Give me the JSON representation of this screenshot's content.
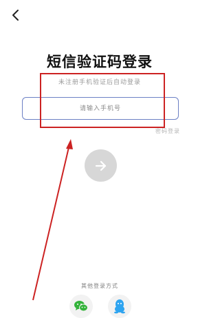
{
  "header": {
    "back_icon": "chevron-left-icon"
  },
  "login": {
    "title": "短信验证码登录",
    "subtitle": "未注册手机验证后自动登录",
    "phone_placeholder": "请输入手机号",
    "password_login_link": "密码登录",
    "next_icon": "arrow-right-icon"
  },
  "other_methods": {
    "label": "其他登录方式",
    "items": [
      {
        "icon": "wechat-icon",
        "color": "#34b33b"
      },
      {
        "icon": "qq-icon",
        "color": "#2ea4f0"
      }
    ]
  },
  "annotation": {
    "color": "#cc2222"
  },
  "colors": {
    "input_border": "#6b7fc4",
    "next_button_bg": "#d7d7d7"
  }
}
